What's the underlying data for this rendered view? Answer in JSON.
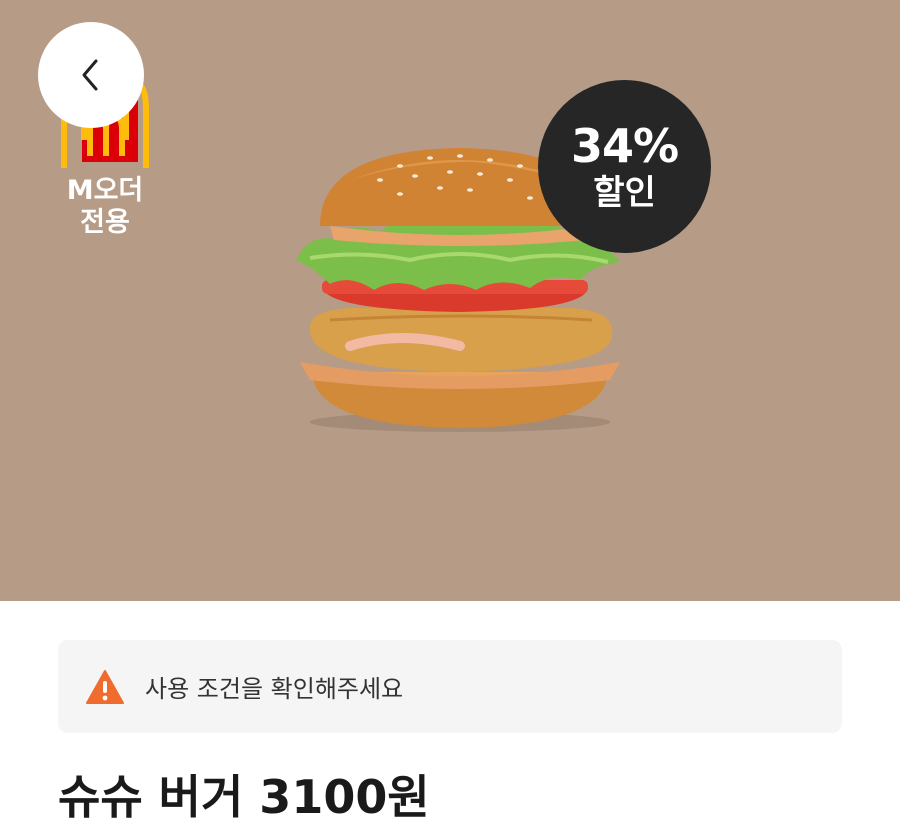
{
  "colors": {
    "hero_background": "#b69b87",
    "discount_badge": "#262626",
    "warning": "#ef6c2e",
    "notice_background": "#f5f5f5",
    "mcd_yellow": "#ffbc0d",
    "mcd_red": "#db0007"
  },
  "header": {
    "back_icon": "chevron-left-icon"
  },
  "brand": {
    "logo_icon": "mcdonalds-arches-icon",
    "tag_line1": "M오더",
    "tag_line2": "전용"
  },
  "discount": {
    "percent": "34%",
    "label": "할인"
  },
  "product": {
    "image": "burger-image",
    "title": "슈슈 버거 3100원"
  },
  "notice": {
    "icon": "warning-icon",
    "text": "사용 조건을 확인해주세요"
  }
}
